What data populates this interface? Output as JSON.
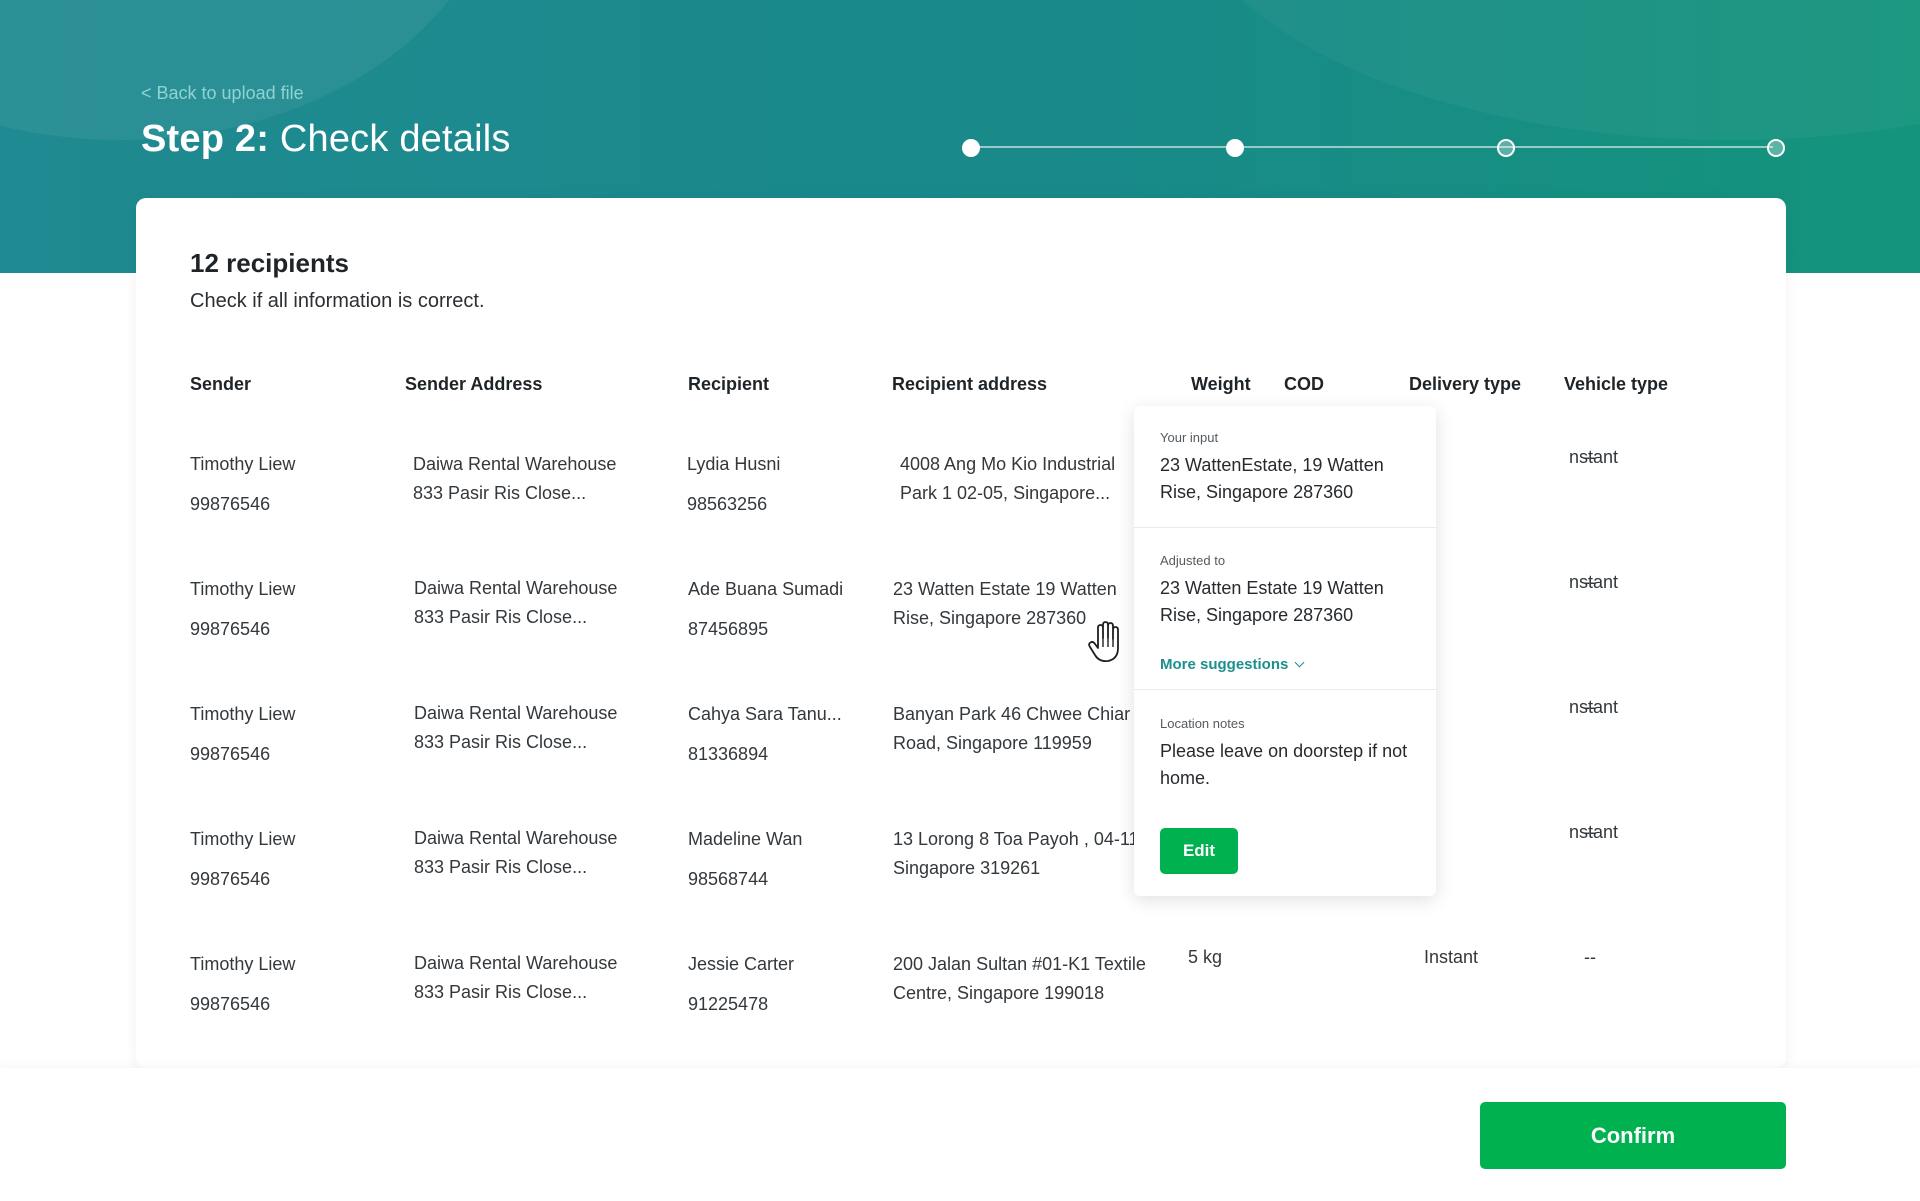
{
  "header": {
    "back_link": "< Back to upload file",
    "step_label": "Step 2:",
    "step_title": " Check details",
    "stepper": {
      "steps_total": 4,
      "steps_completed": 2
    }
  },
  "summary": {
    "count": "12 recipients",
    "subtitle": "Check if all information is correct."
  },
  "columns": [
    "Sender",
    "Sender Address",
    "Recipient",
    "Recipient address",
    "Weight",
    "COD",
    "Delivery type",
    "Vehicle type"
  ],
  "rows": [
    {
      "sender": "Timothy Liew",
      "sender_phone": "99876546",
      "sender_addr1": "Daiwa Rental Warehouse",
      "sender_addr2": "833 Pasir Ris Close...",
      "recipient": "Lydia Husni",
      "recipient_phone": "98563256",
      "recipient_addr1": "4008 Ang Mo Kio Industrial",
      "recipient_addr2": "Park 1 02-05, Singapore...",
      "weight": "",
      "cod": "",
      "delivery": "nstant",
      "vehicle": "--"
    },
    {
      "sender": "Timothy Liew",
      "sender_phone": "99876546",
      "sender_addr1": "Daiwa Rental Warehouse",
      "sender_addr2": "833 Pasir Ris Close...",
      "recipient": "Ade Buana Sumadi",
      "recipient_phone": "87456895",
      "recipient_addr1": "23 Watten Estate 19 Watten",
      "recipient_addr2": "Rise, Singapore 287360",
      "weight": "",
      "cod": "",
      "delivery": "nstant",
      "vehicle": "--"
    },
    {
      "sender": "Timothy Liew",
      "sender_phone": "99876546",
      "sender_addr1": "Daiwa Rental Warehouse",
      "sender_addr2": "833 Pasir Ris Close...",
      "recipient": "Cahya Sara Tanu...",
      "recipient_phone": "81336894",
      "recipient_addr1": "Banyan Park 46 Chwee Chiar",
      "recipient_addr2": "Road, Singapore 119959",
      "weight": "",
      "cod": "",
      "delivery": "nstant",
      "vehicle": "--"
    },
    {
      "sender": "Timothy Liew",
      "sender_phone": "99876546",
      "sender_addr1": "Daiwa Rental Warehouse",
      "sender_addr2": "833 Pasir Ris Close...",
      "recipient": "Madeline Wan",
      "recipient_phone": "98568744",
      "recipient_addr1": "13 Lorong 8 Toa Payoh , 04-11",
      "recipient_addr2": "Singapore 319261",
      "weight": "",
      "cod": "",
      "delivery": "nstant",
      "vehicle": "--"
    },
    {
      "sender": "Timothy Liew",
      "sender_phone": "99876546",
      "sender_addr1": "Daiwa Rental Warehouse",
      "sender_addr2": "833 Pasir Ris Close...",
      "recipient": "Jessie Carter",
      "recipient_phone": "91225478",
      "recipient_addr1": "200 Jalan Sultan #01-K1 Textile",
      "recipient_addr2": "Centre, Singapore 199018",
      "weight": "5 kg",
      "cod": "",
      "delivery": "Instant",
      "vehicle": "--"
    }
  ],
  "popover": {
    "input_label": "Your input",
    "input_value": "23 WattenEstate, 19 Watten Rise, Singapore 287360",
    "adjusted_label": "Adjusted to",
    "adjusted_value": "23 Watten Estate 19 Watten Rise, Singapore 287360",
    "more_suggestions": "More suggestions",
    "notes_label": "Location notes",
    "notes_value": "Please leave on doorstep if not home.",
    "edit_label": "Edit"
  },
  "footer": {
    "confirm_label": "Confirm"
  },
  "colors": {
    "header_teal": "#1f8a91",
    "brand_green": "#00b14f",
    "link_teal": "#1c8f8f"
  },
  "icons": {
    "cursor": "hand-pointer-icon",
    "dropdown": "chevron-down-icon"
  }
}
